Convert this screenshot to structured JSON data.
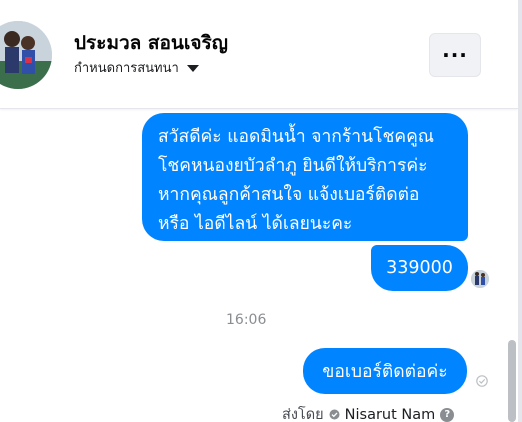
{
  "header": {
    "contact_name": "ประมวล สอนเจริญ",
    "subtitle": "กำหนดการสนทนา",
    "more_label": "···"
  },
  "messages": {
    "greeting_lines": [
      "สวัสดีค่ะ แอดมินน้ำ จากร้านโชคคูณ",
      "โชคหนองยบัวลำภู ยินดีให้บริการค่ะ",
      "หากคุณลูกค้าสนใจ แจ้งเบอร์ติดต่อ",
      "หรือ ไอดีไลน์ ได้เลยนะคะ"
    ],
    "number_reply": "339000",
    "timestamp": "16:06",
    "request": "ขอเบอร์ติดต่อค่ะ"
  },
  "footer": {
    "sent_by_label": "ส่งโดย",
    "sender_name": "Nisarut Nam",
    "help_label": "?"
  },
  "colors": {
    "bubble": "#0084ff",
    "bubble_text": "#ffffff",
    "timestamp": "#8a8d91"
  },
  "icons": {
    "more": "more-options-icon",
    "dropdown": "caret-down-icon",
    "sent": "sent-check-icon",
    "help": "help-icon"
  }
}
